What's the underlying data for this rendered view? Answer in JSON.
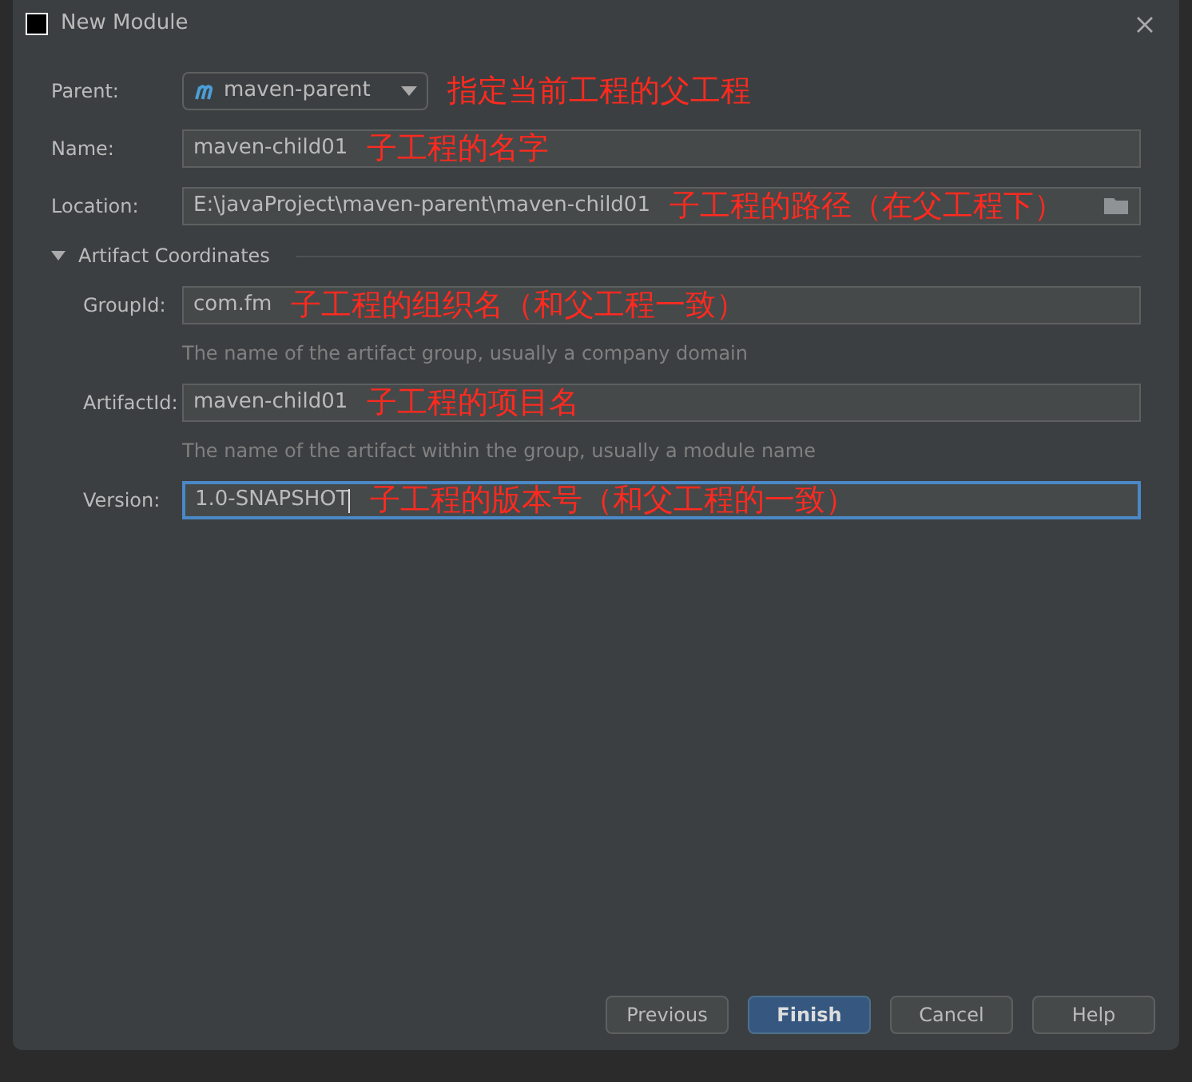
{
  "window": {
    "title": "New Module"
  },
  "fields": [
    {
      "label": "Parent:",
      "kind": "dropdown",
      "value": "maven-parent",
      "annotation": "指定当前工程的父工程",
      "focused": false
    },
    {
      "label": "Name:",
      "kind": "text",
      "value": "maven-child01",
      "annotation": "子工程的名字",
      "focused": false
    },
    {
      "label": "Location:",
      "kind": "path",
      "value": "E:\\javaProject\\maven-parent\\maven-child01",
      "annotation": "子工程的路径（在父工程下）",
      "focused": false
    }
  ],
  "section": {
    "title": "Artifact Coordinates",
    "expanded": true,
    "fields": [
      {
        "label": "GroupId:",
        "value": "com.fm",
        "annotation": "子工程的组织名（和父工程一致）",
        "hint": "The name of the artifact group, usually a company domain",
        "focused": false
      },
      {
        "label": "ArtifactId:",
        "value": "maven-child01",
        "annotation": "子工程的项目名",
        "hint": "The name of the artifact within the group, usually a module name",
        "focused": false
      },
      {
        "label": "Version:",
        "value": "1.0-SNAPSHOT",
        "annotation": "子工程的版本号（和父工程的一致）",
        "focused": true
      }
    ]
  },
  "buttons": [
    {
      "label": "Previous",
      "primary": false
    },
    {
      "label": "Finish",
      "primary": true
    },
    {
      "label": "Cancel",
      "primary": false
    },
    {
      "label": "Help",
      "primary": false
    }
  ]
}
